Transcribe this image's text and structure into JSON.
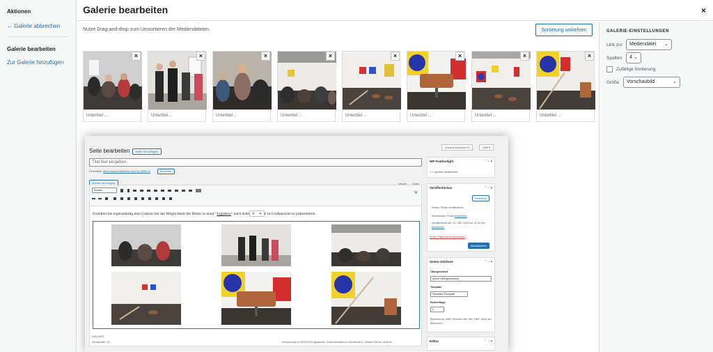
{
  "sidebar": {
    "heading": "Aktionen",
    "cancel_link": "← Galerie abbrechen",
    "edit_heading": "Galerie bearbeiten",
    "add_link": "Zur Galerie hinzufügen"
  },
  "header": {
    "title": "Galerie bearbeiten",
    "close": "×"
  },
  "main": {
    "instruction": "Nutze Drag-and-drop zum Umsortieren der Mediendateien.",
    "reverse_button": "Sortierung umkehren",
    "tiles": [
      {
        "caption": "Untertitel ...",
        "remove": "×"
      },
      {
        "caption": "Untertitel ...",
        "remove": "×"
      },
      {
        "caption": "Untertitel ...",
        "remove": "×"
      },
      {
        "caption": "Untertitel ...",
        "remove": "×"
      },
      {
        "caption": "Untertitel ...",
        "remove": "×"
      },
      {
        "caption": "Untertitel ...",
        "remove": "×"
      },
      {
        "caption": "Untertitel ...",
        "remove": "×"
      },
      {
        "caption": "Untertitel ...",
        "remove": "×"
      }
    ]
  },
  "settings": {
    "title": "GALERIE-EINSTELLUNGEN",
    "link_label": "Link zur",
    "link_value": "Mediendatei",
    "columns_label": "Spalten",
    "columns_value": "4",
    "random_label": "Zufällige Sortierung",
    "size_label": "Größe",
    "size_value": "Vorschaubild",
    "chevron": "⌄"
  },
  "embedded": {
    "page_title": "Seite bearbeiten",
    "add_new": "Seite hinzufügen",
    "screen_options": "Ansicht anpassen ▾",
    "help": "Hilfe ▾",
    "title_placeholder": "Titel hier eingeben",
    "permalink_label": "Permalink:",
    "permalink_url": "https://www.malhiebe.com/?p=8806-2/",
    "permalink_edit": "Bearbeiten",
    "add_media": "Medien hinzufügen",
    "tab_visual": "Visuell",
    "tab_code": "Code",
    "format_select": "Absatz",
    "body_text_before": "Erstellen Sie eigenständig eine Galerie mit der Möglichkeit die Bilder in einer \"",
    "body_link": "Lightbox",
    "body_text_after": "\" nach Anklicken auch in Großansicht zu präsentieren.",
    "footer_tag": "GALLERY",
    "word_count": "Wortanzahl: 21",
    "last_edit": "Entwurf wurde um 18:03:32 Uhr gespeichert. Zuletzt bearbeitet von Schmidt am 21. Oktober 2025 um 15:00 Uhr",
    "box_featherlight": "WP Featherlight",
    "featherlight_option": "Lightbox deaktivieren",
    "box_publish": "Veröffentlichen",
    "preview": "Vorschau",
    "status": "Status: Privat veröffentlicht",
    "visibility": "Sichtbarkeit: Privat",
    "visibility_edit": "bearbeiten",
    "published": "Veröffentlicht am: 22. Okt. 2025 um 11:30 Uhr",
    "published_edit": "Bearbeiten",
    "trash": "In den Papierkorb verschieben",
    "update": "Aktualisieren",
    "box_attributes": "Seiten-Attribute",
    "parent_label": "Übergeordnet",
    "parent_value": "(keine Übergeordnete)",
    "template_label": "Template",
    "template_value": "Standard-Template",
    "order_label": "Reihenfolge",
    "order_value": "0",
    "help_text": "Brauchst du Hilfe? Benutze den Tab „Hilfe“ oben am Bildschirm.",
    "box_editor": "Editor",
    "box_controls": "⌃ ⌄ ▴"
  }
}
